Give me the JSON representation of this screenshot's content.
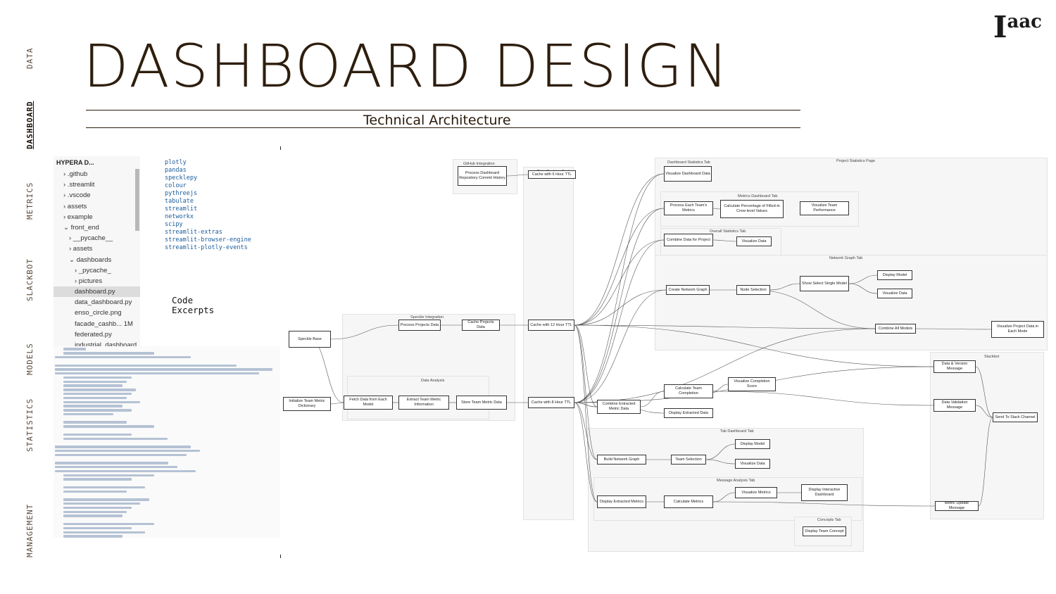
{
  "nav": [
    "DATA",
    "DASHBOARD",
    "METRICS",
    "SLACKBOT",
    "MODELS",
    "STATISTICS",
    "MANAGEMENT"
  ],
  "active_nav": "DASHBOARD",
  "title": "DASHBOARD DESIGN",
  "subtitle": "Technical Architecture",
  "logo": {
    "main": "I",
    "sup": "aac"
  },
  "explorer": {
    "header": "HYPERA D...",
    "items": [
      {
        "label": "› .github",
        "indent": 1
      },
      {
        "label": "› .streamlit",
        "indent": 1
      },
      {
        "label": "› .vscode",
        "indent": 1
      },
      {
        "label": "› assets",
        "indent": 1
      },
      {
        "label": "› example",
        "indent": 1
      },
      {
        "label": "⌄ front_end",
        "indent": 1
      },
      {
        "label": "› __pycache__",
        "indent": 2
      },
      {
        "label": "› assets",
        "indent": 2
      },
      {
        "label": "⌄ dashboards",
        "indent": 2
      },
      {
        "label": "› _pycache_",
        "indent": 3
      },
      {
        "label": "› pictures",
        "indent": 3
      },
      {
        "label": "dashboard.py",
        "indent": 3,
        "selected": true
      },
      {
        "label": "data_dashboard.py",
        "indent": 3
      },
      {
        "label": "enso_circle.png",
        "indent": 3
      },
      {
        "label": "facade_cashb...  1M",
        "indent": 3
      },
      {
        "label": "federated.py",
        "indent": 3
      },
      {
        "label": "industrial_dashboard...",
        "indent": 3
      }
    ]
  },
  "dependencies": [
    "plotly",
    "pandas",
    "specklepy",
    "colour",
    "pythreejs",
    "tabulate",
    "streamlit",
    "networkx",
    "scipy",
    "streamlit-extras",
    "streamlit-browser-engine",
    "streamlit-plotly-events"
  ],
  "code_excerpts_label": [
    "Code",
    "Excerpts"
  ],
  "diagram": {
    "panels": [
      {
        "title": "GitHub Integration"
      },
      {
        "title": "Data Caching System"
      },
      {
        "title": "Dashboard Statistics Tab"
      },
      {
        "title": "Project Statistics Page"
      },
      {
        "title": "Metrics Dashboard Tab"
      },
      {
        "title": "Overall Statistics Tab"
      },
      {
        "title": "Network Graph Tab"
      },
      {
        "title": "Speckle Integration"
      },
      {
        "title": "Data Analysis"
      },
      {
        "title": "Slackbot"
      },
      {
        "title": "Tab Dashboard Tab"
      },
      {
        "title": "Message Analysis Tab"
      },
      {
        "title": "Concepts Tab"
      }
    ],
    "nodes": [
      "Process Dashboard Repository Commit History",
      "Cache with 6 Hour TTL",
      "Visualize Dashboard Data",
      "Process Each Team's Metrics",
      "Calculate Percentage of Filled-in Crew-level Values",
      "Visualize Team Performance",
      "Combine Data for Project",
      "Visualize Data",
      "Create Network Graph",
      "Node Selection",
      "Show Select Single Model",
      "Display Model",
      "Visualize Data",
      "Combine All Models",
      "Visualize Project Data in Each Mode",
      "Speckle Base",
      "Process Projects Data",
      "Cache Projects Data",
      "Cache with 12 Hour TTL",
      "Initialize Team Metric Dictionary",
      "Fetch Data from Each Model",
      "Extract Team Metric Information",
      "Store Team Metric Data",
      "Cache with 8 Hour TTL",
      "Combine Extracted Metric Data",
      "Calculate Team Completion",
      "Visualize Completion Score",
      "Display Extracted Data",
      "Build Network Graph",
      "Team Selection",
      "Display Model",
      "Visualize Data",
      "Display Extracted Metrics",
      "Calculate Metrics",
      "Visualize Metrics",
      "Display Interactive Dashboard",
      "Display Team Concept",
      "Data & Version Message",
      "Data Validation Message",
      "Send To Slack Channel",
      "Metric Update Message"
    ]
  }
}
